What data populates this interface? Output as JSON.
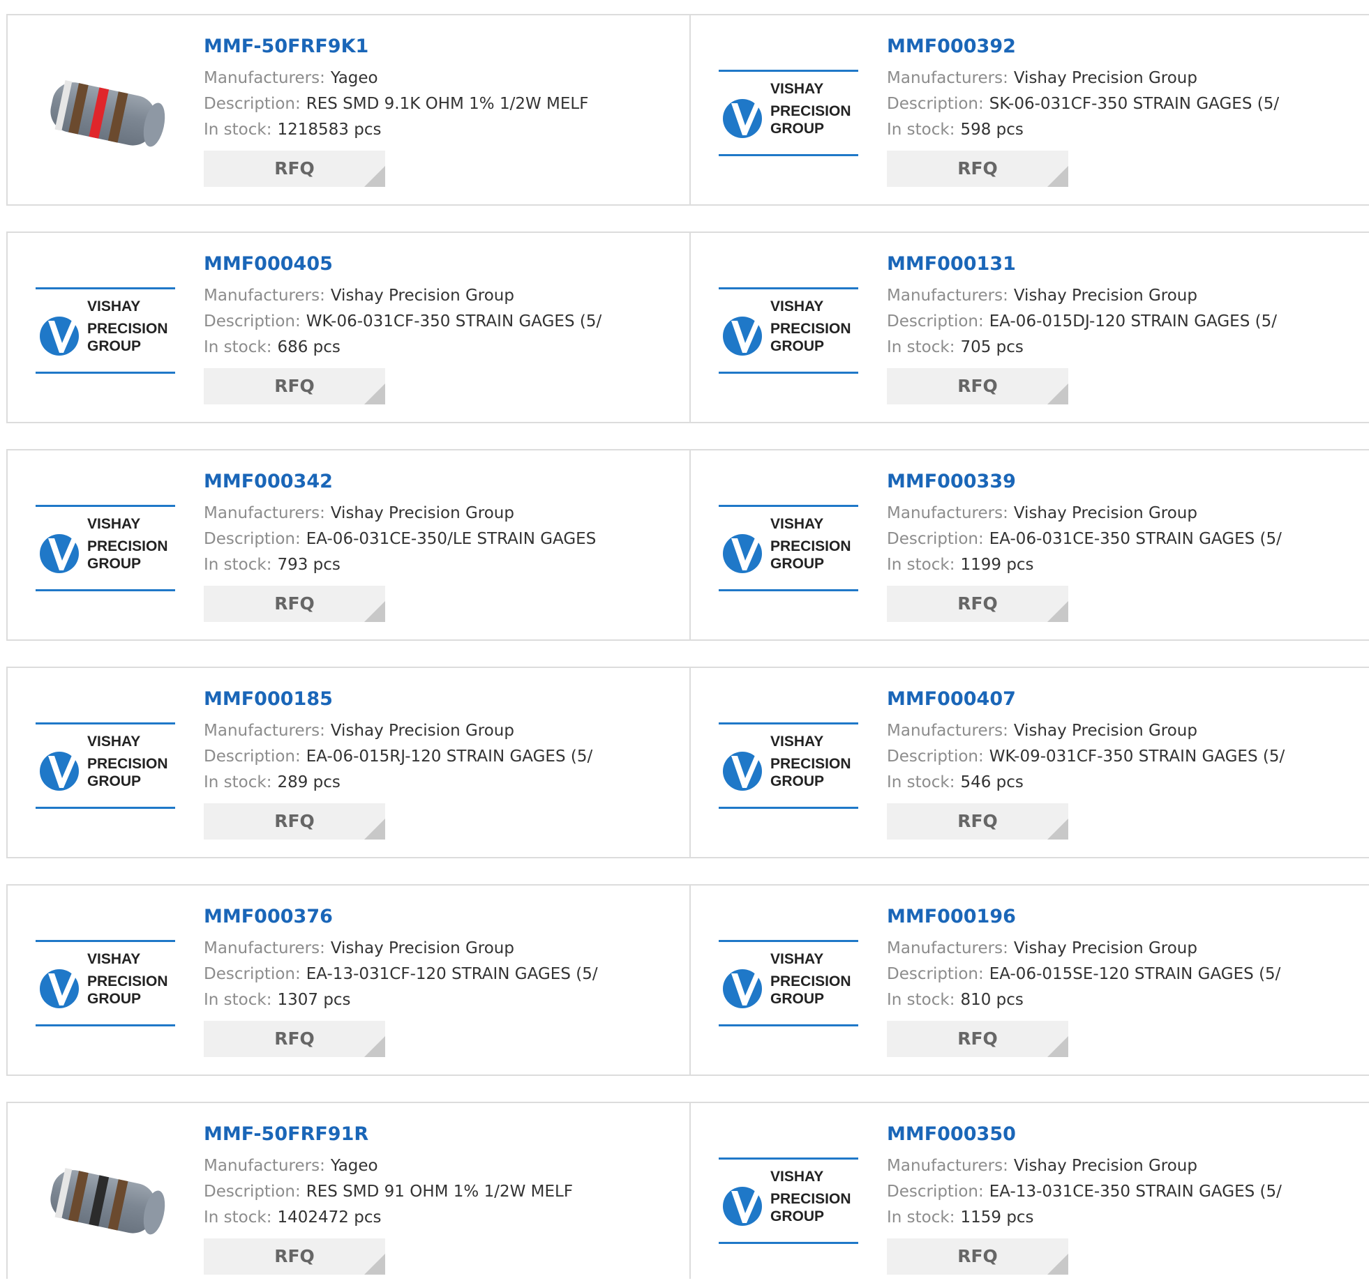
{
  "labels": {
    "manufacturer": "Manufacturers:",
    "description": "Description:",
    "stock": "In stock:",
    "rfq": "RFQ"
  },
  "logo": {
    "line1": "VISHAY",
    "line2": "PRECISION",
    "line3": "GROUP"
  },
  "colors": {
    "link": "#1a66b8",
    "vishay_blue": "#1f78c8",
    "border": "#dcdcdc"
  },
  "products": [
    {
      "pn": "MMF-50FRF9K1",
      "manufacturer": "Yageo",
      "description": "RES SMD 9.1K OHM 1% 1/2W MELF",
      "stock": "1218583 pcs",
      "image": "resistor-red"
    },
    {
      "pn": "MMF000392",
      "manufacturer": "Vishay Precision Group",
      "description": "SK-06-031CF-350 STRAIN GAGES (5/",
      "stock": "598 pcs",
      "image": "vishay-logo"
    },
    {
      "pn": "MMF000405",
      "manufacturer": "Vishay Precision Group",
      "description": "WK-06-031CF-350 STRAIN GAGES (5/",
      "stock": "686 pcs",
      "image": "vishay-logo"
    },
    {
      "pn": "MMF000131",
      "manufacturer": "Vishay Precision Group",
      "description": "EA-06-015DJ-120 STRAIN GAGES (5/",
      "stock": "705 pcs",
      "image": "vishay-logo"
    },
    {
      "pn": "MMF000342",
      "manufacturer": "Vishay Precision Group",
      "description": "EA-06-031CE-350/LE STRAIN GAGES",
      "stock": "793 pcs",
      "image": "vishay-logo"
    },
    {
      "pn": "MMF000339",
      "manufacturer": "Vishay Precision Group",
      "description": "EA-06-031CE-350 STRAIN GAGES (5/",
      "stock": "1199 pcs",
      "image": "vishay-logo"
    },
    {
      "pn": "MMF000185",
      "manufacturer": "Vishay Precision Group",
      "description": "EA-06-015RJ-120 STRAIN GAGES (5/",
      "stock": "289 pcs",
      "image": "vishay-logo"
    },
    {
      "pn": "MMF000407",
      "manufacturer": "Vishay Precision Group",
      "description": "WK-09-031CF-350 STRAIN GAGES (5/",
      "stock": "546 pcs",
      "image": "vishay-logo"
    },
    {
      "pn": "MMF000376",
      "manufacturer": "Vishay Precision Group",
      "description": "EA-13-031CF-120 STRAIN GAGES (5/",
      "stock": "1307 pcs",
      "image": "vishay-logo"
    },
    {
      "pn": "MMF000196",
      "manufacturer": "Vishay Precision Group",
      "description": "EA-06-015SE-120 STRAIN GAGES (5/",
      "stock": "810 pcs",
      "image": "vishay-logo"
    },
    {
      "pn": "MMF-50FRF91R",
      "manufacturer": "Yageo",
      "description": "RES SMD 91 OHM 1% 1/2W MELF",
      "stock": "1402472 pcs",
      "image": "resistor-black"
    },
    {
      "pn": "MMF000350",
      "manufacturer": "Vishay Precision Group",
      "description": "EA-13-031CE-350 STRAIN GAGES (5/",
      "stock": "1159 pcs",
      "image": "vishay-logo"
    }
  ]
}
